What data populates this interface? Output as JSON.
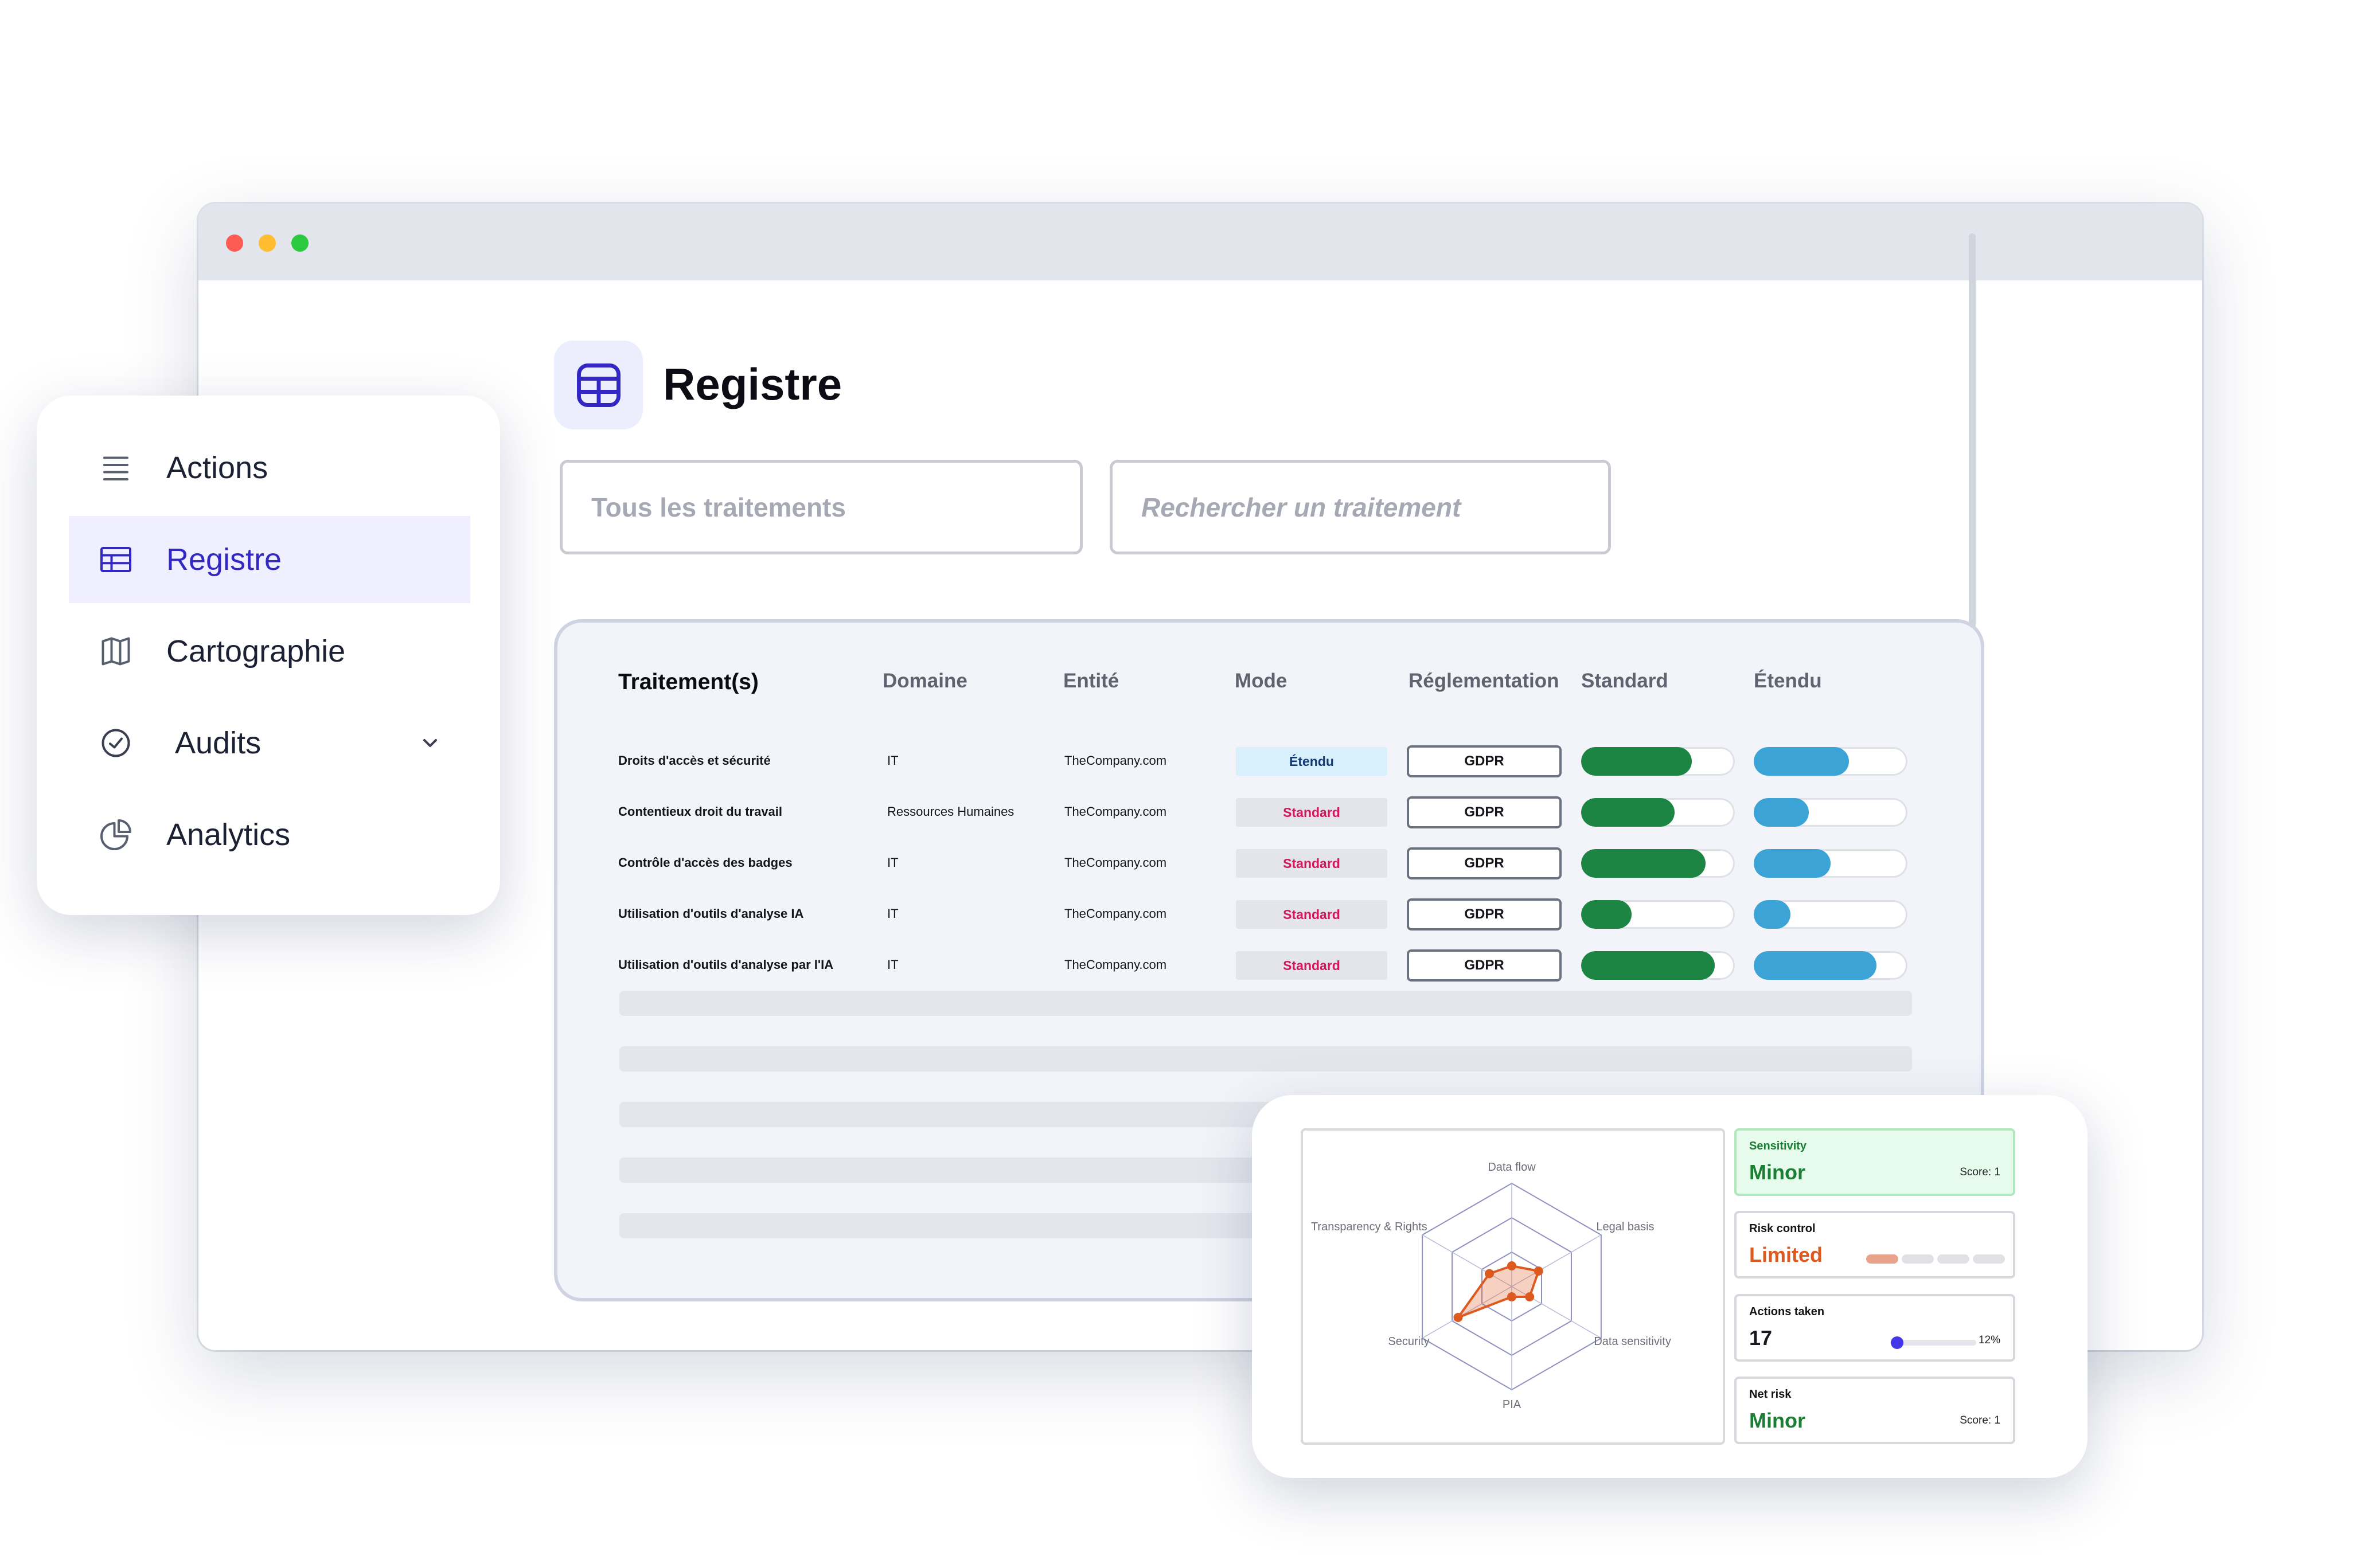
{
  "app": {
    "page_title": "Registre"
  },
  "filters": {
    "all_label": "Tous les traitements",
    "search_placeholder": "Rechercher un traitement"
  },
  "sidebar": {
    "items": [
      {
        "label": "Actions",
        "icon": "list-icon"
      },
      {
        "label": "Registre",
        "icon": "table-icon",
        "active": true
      },
      {
        "label": "Cartographie",
        "icon": "map-icon"
      },
      {
        "label": "Audits",
        "icon": "check-badge-icon",
        "has_dropdown": true
      },
      {
        "label": "Analytics",
        "icon": "pie-chart-icon"
      }
    ]
  },
  "table": {
    "headers": [
      "Traitement(s)",
      "Domaine",
      "Entité",
      "Mode",
      "Réglementation",
      "Standard",
      "Étendu"
    ],
    "rows": [
      {
        "name": "Droits d'accès et sécurité",
        "domain": "IT",
        "entity": "TheCompany.com",
        "mode": "Étendu",
        "regulation": "GDPR",
        "standard": 0.72,
        "extended": 0.62
      },
      {
        "name": "Contentieux droit du travail",
        "domain": "Ressources Humaines",
        "entity": "TheCompany.com",
        "mode": "Standard",
        "regulation": "GDPR",
        "standard": 0.61,
        "extended": 0.36
      },
      {
        "name": "Contrôle d'accès des badges",
        "domain": "IT",
        "entity": "TheCompany.com",
        "mode": "Standard",
        "regulation": "GDPR",
        "standard": 0.81,
        "extended": 0.5
      },
      {
        "name": "Utilisation d'outils d'analyse IA",
        "domain": "IT",
        "entity": "TheCompany.com",
        "mode": "Standard",
        "regulation": "GDPR",
        "standard": 0.33,
        "extended": 0.24
      },
      {
        "name": "Utilisation d'outils d'analyse par l'IA",
        "domain": "IT",
        "entity": "TheCompany.com",
        "mode": "Standard",
        "regulation": "GDPR",
        "standard": 0.87,
        "extended": 0.8
      }
    ]
  },
  "risk": {
    "radar": {
      "axes": [
        "Data flow",
        "Legal basis",
        "Data sensitivity",
        "PIA",
        "Security",
        "Transparency & Rights"
      ],
      "values": [
        0.2,
        0.3,
        0.2,
        0.1,
        0.6,
        0.25
      ]
    },
    "sensitivity": {
      "title": "Sensitivity",
      "value": "Minor",
      "score": "Score: 1"
    },
    "risk_control": {
      "title": "Risk control",
      "value": "Limited",
      "segments_on": 1,
      "segments_total": 4
    },
    "actions_taken": {
      "title": "Actions taken",
      "value": "17",
      "percent_label": "12%",
      "percent": 0.12
    },
    "net_risk": {
      "title": "Net risk",
      "value": "Minor",
      "score": "Score: 1"
    }
  },
  "colors": {
    "accent": "#3227c2",
    "standard_bar": "#1d8543",
    "extended_bar": "#3ba3d5",
    "mode_standard_text": "#d2185a",
    "risk_orange": "#dc5a1f"
  }
}
